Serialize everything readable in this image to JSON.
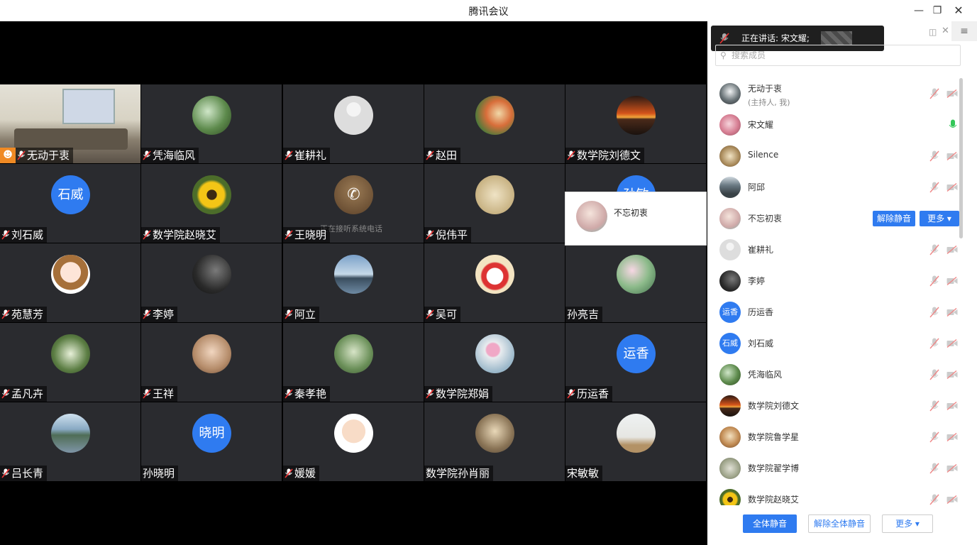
{
  "window": {
    "title": "腾讯会议"
  },
  "tiles": [
    {
      "name": "无动于衷",
      "avatar": "meeting-room-photo"
    },
    {
      "name": "凭海临风",
      "avatar": "plants-photo"
    },
    {
      "name": "崔耕礼",
      "avatar": "default-person"
    },
    {
      "name": "赵田",
      "avatar": "cartoon-photo"
    },
    {
      "name": "数学院刘德文",
      "avatar": "sunset-photo"
    },
    {
      "name": "刘石威",
      "avatar_text": "石威"
    },
    {
      "name": "数学院赵晓艾",
      "avatar": "sunflower-photo"
    },
    {
      "name": "王晓明",
      "avatar": "phone-call",
      "status": "正在接听系统电话"
    },
    {
      "name": "倪伟平",
      "avatar": "painting-photo"
    },
    {
      "name": "",
      "avatar_text": "孙敏"
    },
    {
      "name": "苑慧芳",
      "avatar": "cartoon-girl"
    },
    {
      "name": "李婷",
      "avatar": "dark-photo"
    },
    {
      "name": "阿立",
      "avatar": "lake-photo"
    },
    {
      "name": "吴可",
      "avatar": "lucky-cat-photo"
    },
    {
      "name": "孙亮吉",
      "avatar": "lotus-photo"
    },
    {
      "name": "孟凡卉",
      "avatar": "flowers-photo"
    },
    {
      "name": "王祥",
      "avatar": "glasses-photo"
    },
    {
      "name": "秦孝艳",
      "avatar": "garden-photo"
    },
    {
      "name": "数学院郑娟",
      "avatar": "cosmos-photo"
    },
    {
      "name": "历运香",
      "avatar_text": "运香"
    },
    {
      "name": "吕长青",
      "avatar": "river-town-photo"
    },
    {
      "name": "孙晓明",
      "avatar_text": "晓明"
    },
    {
      "name": "媛媛",
      "avatar": "baby-photo"
    },
    {
      "name": "数学院孙肖丽",
      "avatar": "child-photo"
    },
    {
      "name": "宋敏敏",
      "avatar": "girl-photo"
    }
  ],
  "popup": {
    "name": "不忘初衷"
  },
  "speaking": {
    "text": "正在讲话: 宋文耀;"
  },
  "panel": {
    "search_placeholder": "搜索成员",
    "members": [
      {
        "name": "无动于衷",
        "sub": "(主持人, 我)",
        "avatar": "person-photo"
      },
      {
        "name": "宋文耀",
        "avatar": "sakura-photo",
        "mic": "active"
      },
      {
        "name": "Silence",
        "avatar": "cat-photo"
      },
      {
        "name": "阿邱",
        "avatar": "mountain-photo"
      },
      {
        "name": "不忘初衷",
        "avatar": "portrait-photo",
        "actions": [
          "解除静音",
          "更多 ▾"
        ]
      },
      {
        "name": "崔耕礼",
        "avatar": "default-person"
      },
      {
        "name": "李婷",
        "avatar": "dark-photo"
      },
      {
        "name": "历运香",
        "avatar_text": "运香"
      },
      {
        "name": "刘石威",
        "avatar_text": "石威"
      },
      {
        "name": "凭海临风",
        "avatar": "plants-photo"
      },
      {
        "name": "数学院刘德文",
        "avatar": "sunset-photo"
      },
      {
        "name": "数学院鲁学星",
        "avatar": "bamboo-photo"
      },
      {
        "name": "数学院翟学博",
        "avatar": "rock-photo"
      },
      {
        "name": "数学院赵晓艾",
        "avatar": "sunflower-photo"
      }
    ]
  },
  "footer": {
    "mute_all": "全体静音",
    "unmute_all": "解除全体静音",
    "more": "更多 ▾"
  },
  "colors": {
    "accent": "#2f7bf0",
    "tile_bg": "#2a2b2f",
    "speaking_mic": "#34c759"
  }
}
